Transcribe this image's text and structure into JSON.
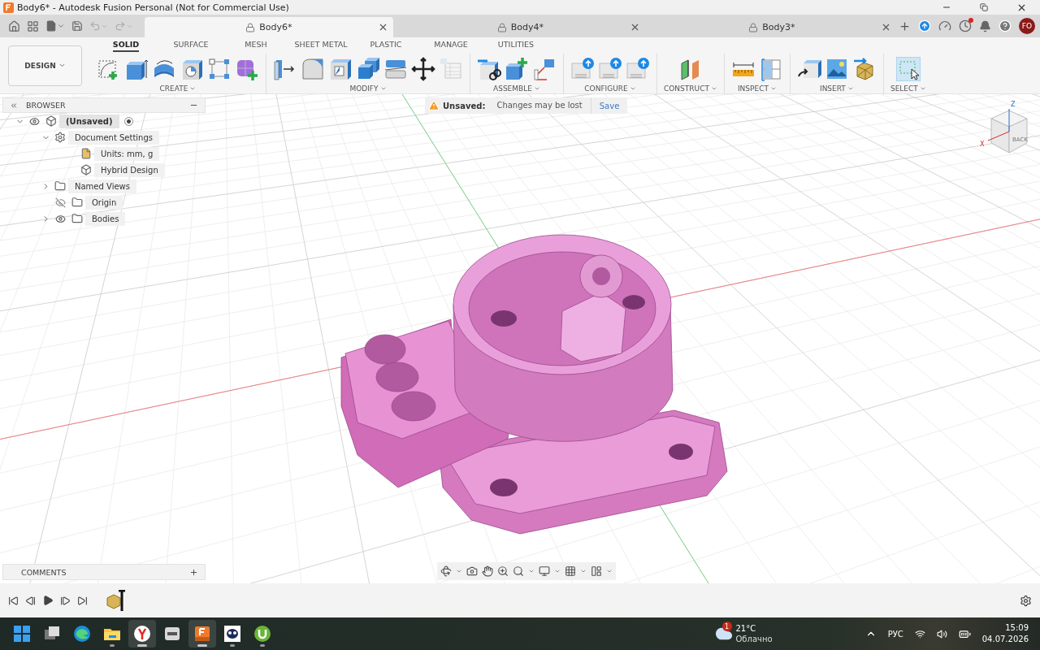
{
  "window": {
    "title": "Body6* - Autodesk Fusion Personal (Not for Commercial Use)"
  },
  "tabs": [
    {
      "label": "Body6*",
      "selected": true
    },
    {
      "label": "Body4*",
      "selected": false
    },
    {
      "label": "Body3*",
      "selected": false
    }
  ],
  "user": {
    "initials": "FO",
    "notification": true
  },
  "workspace": {
    "label": "DESIGN"
  },
  "ribbon_tabs": [
    {
      "label": "SOLID",
      "selected": true
    },
    {
      "label": "SURFACE",
      "selected": false
    },
    {
      "label": "MESH",
      "selected": false
    },
    {
      "label": "SHEET METAL",
      "selected": false
    },
    {
      "label": "PLASTIC",
      "selected": false
    },
    {
      "label": "MANAGE",
      "selected": false
    },
    {
      "label": "UTILITIES",
      "selected": false
    }
  ],
  "ribbon_groups": [
    {
      "label": "CREATE"
    },
    {
      "label": "MODIFY"
    },
    {
      "label": "ASSEMBLE"
    },
    {
      "label": "CONFIGURE"
    },
    {
      "label": "CONSTRUCT"
    },
    {
      "label": "INSPECT"
    },
    {
      "label": "INSERT"
    },
    {
      "label": "SELECT"
    }
  ],
  "browser": {
    "title": "BROWSER",
    "tree": [
      {
        "label": "(Unsaved)",
        "kind": "component",
        "selected": true,
        "expanded": true,
        "visible": true,
        "active": true,
        "children": [
          {
            "label": "Document Settings",
            "kind": "settings",
            "selected": false,
            "expanded": true,
            "children": [
              {
                "label": "Units: mm, g",
                "kind": "units",
                "selected": false
              },
              {
                "label": "Hybrid Design",
                "kind": "design",
                "selected": false
              }
            ]
          },
          {
            "label": "Named Views",
            "kind": "folder",
            "selected": false,
            "expanded": false
          },
          {
            "label": "Origin",
            "kind": "folder",
            "selected": false,
            "visible": false
          },
          {
            "label": "Bodies",
            "kind": "folder",
            "selected": false,
            "expanded": false,
            "visible": true
          }
        ]
      }
    ]
  },
  "banner": {
    "label": "Unsaved:",
    "message": "Changes may be lost",
    "action": "Save"
  },
  "view_cube": {
    "face": "BACK",
    "x": "X",
    "z": "Z"
  },
  "comments": {
    "title": "COMMENTS"
  },
  "taskbar": {
    "apps": [
      {
        "kind": "start",
        "active": false,
        "running": false
      },
      {
        "kind": "taskview",
        "active": false,
        "running": false
      },
      {
        "kind": "edge",
        "active": false,
        "running": false
      },
      {
        "kind": "explorer",
        "active": false,
        "running": true
      },
      {
        "kind": "yandex",
        "active": true,
        "running": true
      },
      {
        "kind": "live",
        "active": false,
        "running": false
      },
      {
        "kind": "fusion",
        "active": true,
        "running": true
      },
      {
        "kind": "game",
        "active": false,
        "running": true
      },
      {
        "kind": "torrent",
        "active": false,
        "running": true
      }
    ],
    "weather": {
      "badge": "1",
      "temperature": "21°C",
      "condition": "Облачно"
    },
    "language": "РУС",
    "time": "15:09",
    "date": "04.07.2026"
  }
}
